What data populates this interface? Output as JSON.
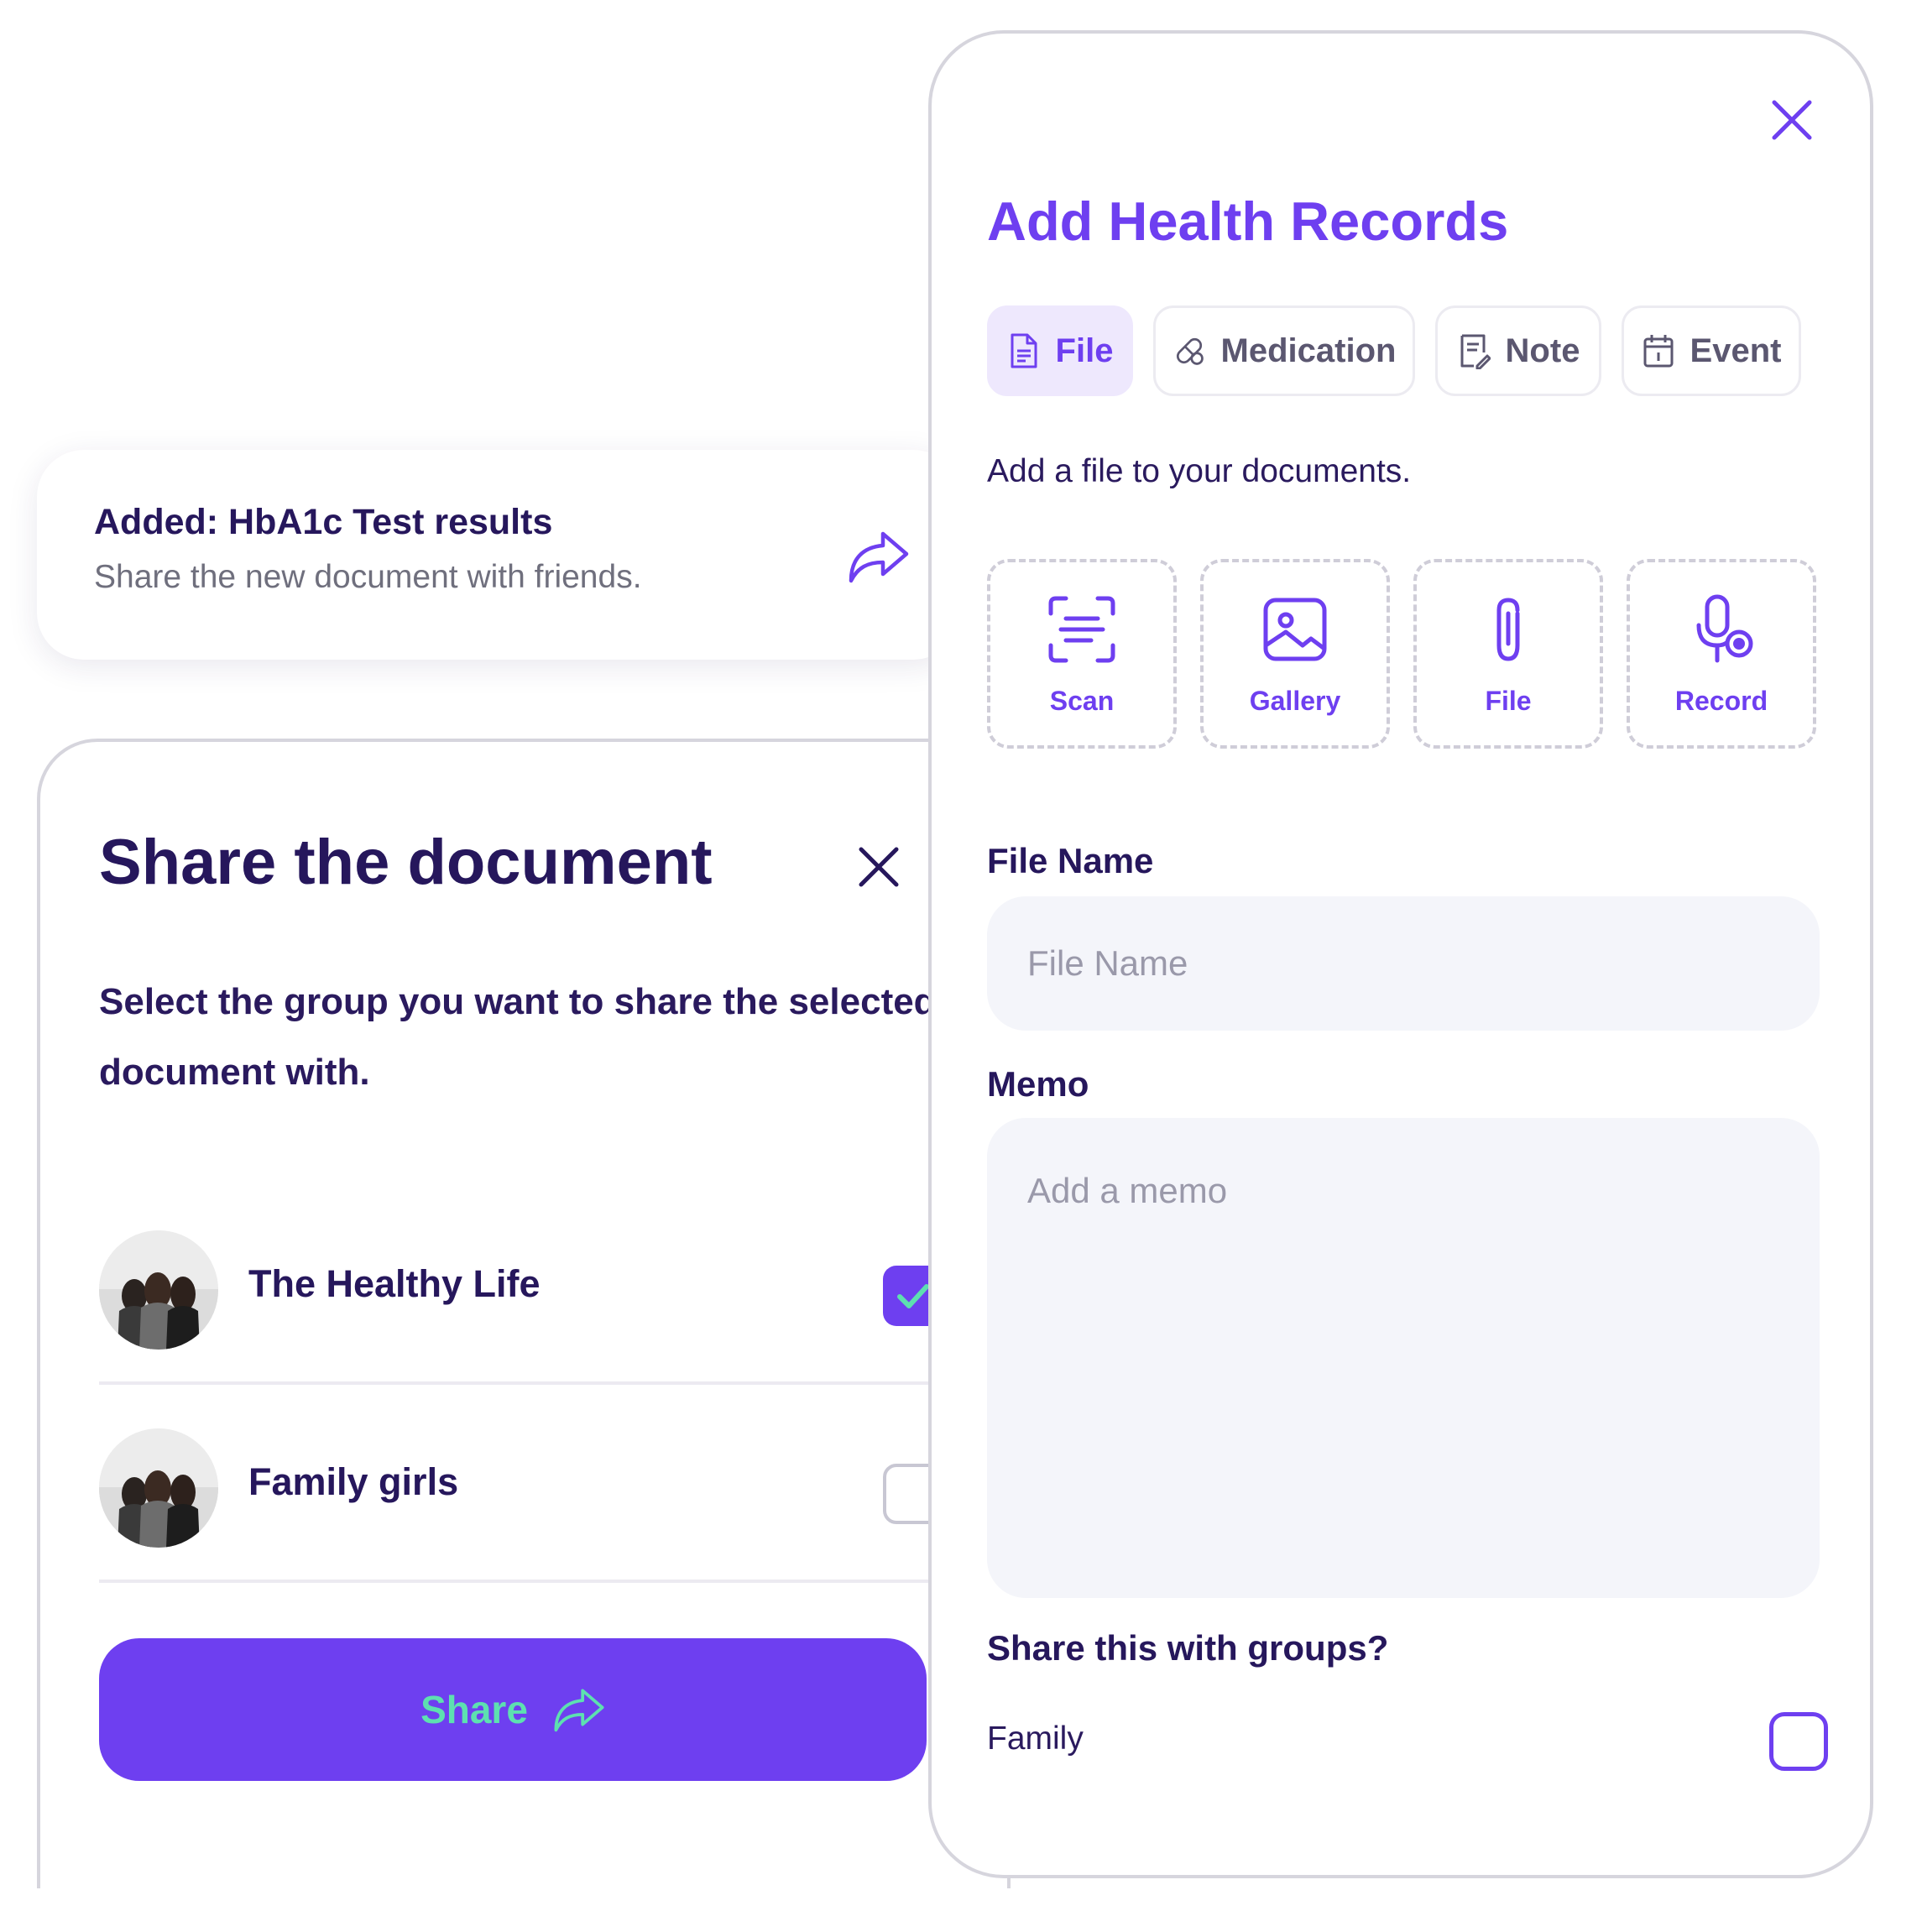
{
  "colors": {
    "accent": "#6e3ff0",
    "accent_light": "#eee8fd",
    "share_label": "#5de0b0",
    "text_dark": "#26175c",
    "muted": "#6f6f7d",
    "input_bg": "#f4f5fa"
  },
  "notification": {
    "title": "Added: HbA1c Test results",
    "subtitle": "Share the new document with friends.",
    "icon": "share-arrow-icon"
  },
  "share_dialog": {
    "title": "Share the document",
    "description": "Select the group you want to share the selected document with.",
    "close_icon": "close-icon",
    "groups": [
      {
        "name": "The Healthy Life",
        "checked": true,
        "avatar": "group-photo"
      },
      {
        "name": "Family girls",
        "checked": false,
        "avatar": "group-photo"
      }
    ],
    "share_button_label": "Share",
    "share_button_icon": "share-arrow-icon"
  },
  "records": {
    "title": "Add Health Records",
    "close_icon": "close-icon",
    "tabs": [
      {
        "label": "File",
        "icon": "document-icon",
        "active": true
      },
      {
        "label": "Medication",
        "icon": "pill-icon",
        "active": false
      },
      {
        "label": "Note",
        "icon": "note-icon",
        "active": false
      },
      {
        "label": "Event",
        "icon": "calendar-icon",
        "active": false
      }
    ],
    "hint": "Add a file to your documents.",
    "upload_options": [
      {
        "label": "Scan",
        "icon": "scan-icon"
      },
      {
        "label": "Gallery",
        "icon": "image-icon"
      },
      {
        "label": "File",
        "icon": "paperclip-icon"
      },
      {
        "label": "Record",
        "icon": "microphone-icon"
      }
    ],
    "file_name": {
      "label": "File Name",
      "placeholder": "File Name",
      "value": ""
    },
    "memo": {
      "label": "Memo",
      "placeholder": "Add a memo",
      "value": ""
    },
    "share_question": "Share this with groups?",
    "groups": [
      {
        "name": "Family",
        "checked": false
      }
    ]
  }
}
